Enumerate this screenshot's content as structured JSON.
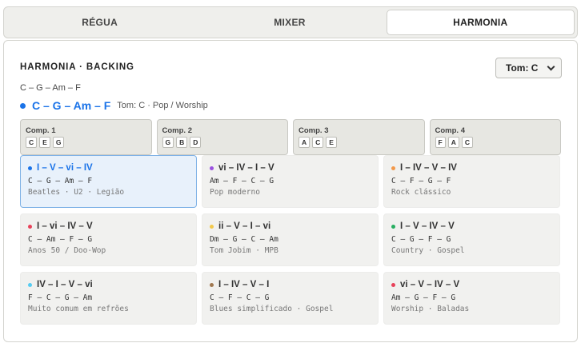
{
  "tabs": [
    {
      "label": "RÉGUA"
    },
    {
      "label": "MIXER"
    },
    {
      "label": "HARMONIA",
      "active": true
    }
  ],
  "panel": {
    "title": "HARMONIA · BACKING",
    "tom_select": {
      "value": "Tom: C"
    },
    "progression_small": "C – G – Am – F",
    "current": {
      "progression": "C – G – Am – F",
      "meta": "Tom: C · Pop / Worship",
      "color": "#1a73e8"
    }
  },
  "compassos": [
    {
      "label": "Comp. 1",
      "notes": [
        "C",
        "E",
        "G"
      ]
    },
    {
      "label": "Comp. 2",
      "notes": [
        "G",
        "B",
        "D"
      ]
    },
    {
      "label": "Comp. 3",
      "notes": [
        "A",
        "C",
        "E"
      ]
    },
    {
      "label": "Comp. 4",
      "notes": [
        "F",
        "A",
        "C"
      ]
    }
  ],
  "progressions": [
    {
      "title": "I – V – vi – IV",
      "chords": "C – G – Am – F",
      "desc": "Beatles · U2 · Legião",
      "color": "#1a73e8",
      "selected": true
    },
    {
      "title": "vi – IV – I – V",
      "chords": "Am – F – C – G",
      "desc": "Pop moderno",
      "color": "#9b51e0"
    },
    {
      "title": "I – IV – V – IV",
      "chords": "C – F – G – F",
      "desc": "Rock clássico",
      "color": "#f2994a"
    },
    {
      "title": "I – vi – IV – V",
      "chords": "C – Am – F – G",
      "desc": "Anos 50 / Doo-Wop",
      "color": "#e8425a"
    },
    {
      "title": "ii – V – I – vi",
      "chords": "Dm – G – C – Am",
      "desc": "Tom Jobim · MPB",
      "color": "#f2c94c"
    },
    {
      "title": "I – V – IV – V",
      "chords": "C – G – F – G",
      "desc": "Country · Gospel",
      "color": "#27ae60"
    },
    {
      "title": "IV – I – V – vi",
      "chords": "F – C – G – Am",
      "desc": "Muito comum em refrões",
      "color": "#56ccf2"
    },
    {
      "title": "I – IV – V – I",
      "chords": "C – F – C – G",
      "desc": "Blues simplificado · Gospel",
      "color": "#a07850"
    },
    {
      "title": "vi – V – IV – V",
      "chords": "Am – G – F – G",
      "desc": "Worship · Baladas",
      "color": "#e8425a"
    }
  ]
}
